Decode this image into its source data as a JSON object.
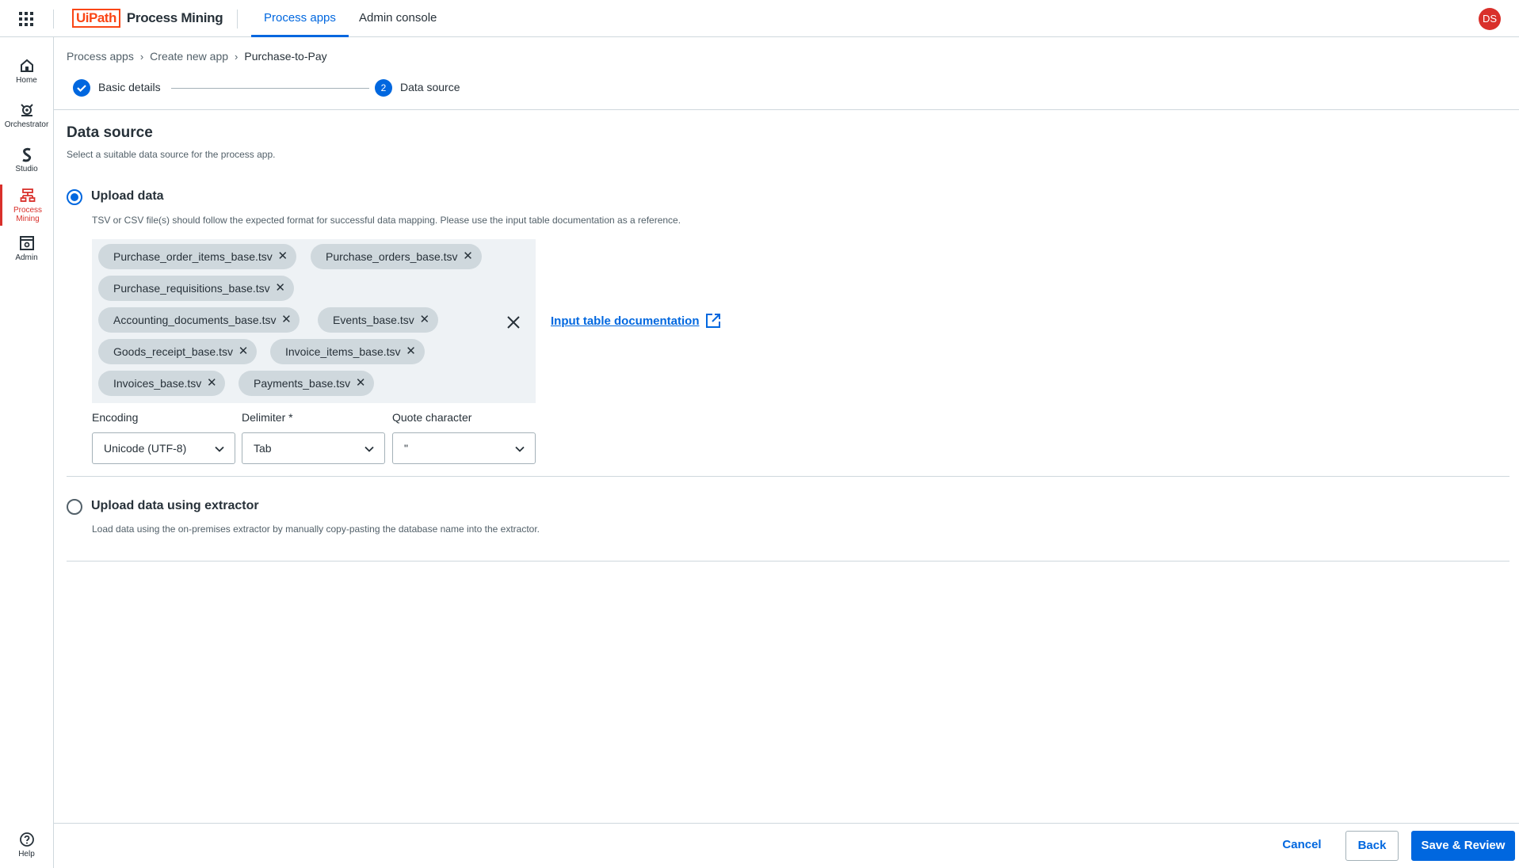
{
  "topbar": {
    "logo_brand": "UiPath",
    "logo_product": "Process Mining",
    "tabs": [
      {
        "label": "Process apps",
        "active": true
      },
      {
        "label": "Admin console",
        "active": false
      }
    ],
    "avatar_initials": "DS"
  },
  "rail": {
    "items": [
      {
        "label": "Home",
        "icon": "home-icon"
      },
      {
        "label": "Orchestrator",
        "icon": "orchestrator-icon"
      },
      {
        "label": "Studio",
        "icon": "studio-icon"
      },
      {
        "label": "Process Mining",
        "icon": "process-mining-icon",
        "active": true
      },
      {
        "label": "Admin",
        "icon": "admin-icon"
      }
    ],
    "help_label": "Help"
  },
  "breadcrumb": {
    "items": [
      "Process apps",
      "Create new app",
      "Purchase-to-Pay"
    ],
    "separator": "›"
  },
  "stepper": {
    "steps": [
      {
        "label": "Basic details",
        "state": "done"
      },
      {
        "label": "Data source",
        "number": "2",
        "state": "active"
      }
    ]
  },
  "main": {
    "title": "Data source",
    "subtitle": "Select a suitable data source for the process app.",
    "options": [
      {
        "title": "Upload data",
        "selected": true,
        "description": "TSV or CSV file(s) should follow the expected format for successful data mapping. Please use the input table documentation as a reference."
      },
      {
        "title": "Upload data using extractor",
        "selected": false,
        "description": "Load data using the on-premises extractor by manually copy-pasting the database name into the extractor."
      }
    ],
    "files": [
      "Purchase_order_items_base.tsv",
      "Purchase_orders_base.tsv",
      "Purchase_requisitions_base.tsv",
      "Accounting_documents_base.tsv",
      "Events_base.tsv",
      "Goods_receipt_base.tsv",
      "Invoice_items_base.tsv",
      "Invoices_base.tsv",
      "Payments_base.tsv"
    ],
    "doc_link": "Input table documentation",
    "fields": {
      "encoding": {
        "label": "Encoding",
        "value": "Unicode (UTF-8)"
      },
      "delimiter": {
        "label": "Delimiter *",
        "value": "Tab"
      },
      "quote": {
        "label": "Quote character",
        "value": "\""
      }
    }
  },
  "footer": {
    "cancel": "Cancel",
    "back": "Back",
    "save": "Save & Review"
  },
  "colors": {
    "accent": "#0067df",
    "brand": "#fa4616",
    "rail_active": "#d9302b"
  }
}
